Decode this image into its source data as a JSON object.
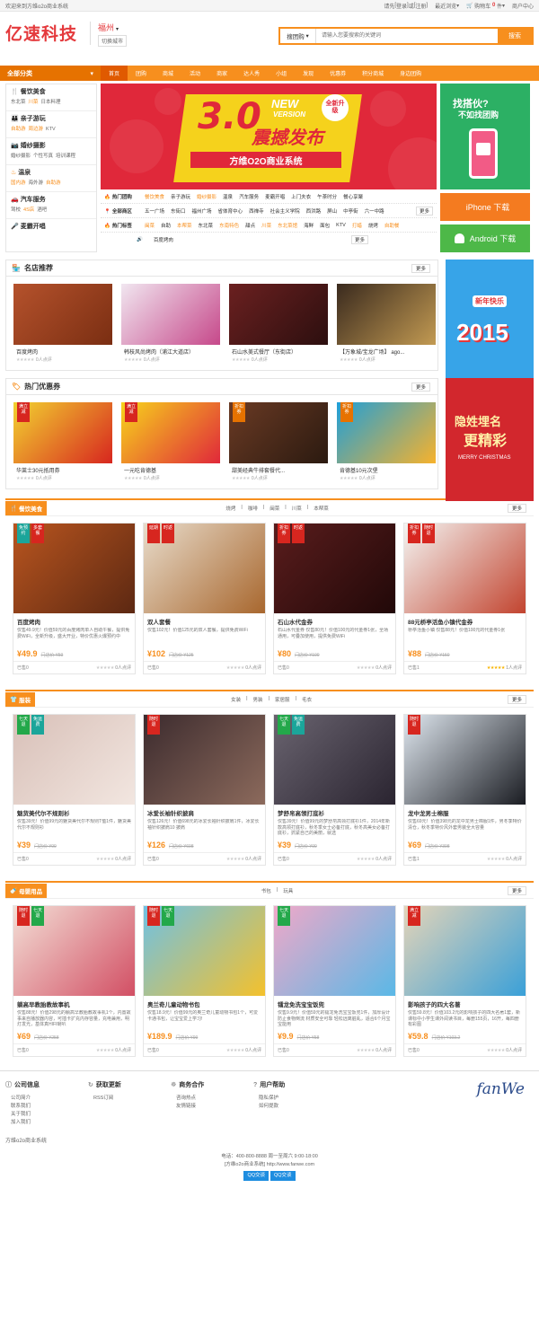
{
  "topbar": {
    "welcome": "欢迎来到方维o2o商业系统",
    "login_prompt": "请先",
    "login": "登录",
    "or": "或",
    "register": "注册",
    "recent": "最近浏览",
    "cart": "购物车",
    "cart_count": "0",
    "cart_unit": "件",
    "merchant": "商户中心"
  },
  "header": {
    "logo": "亿速科技",
    "city": "福州",
    "switch_city": "切换城市"
  },
  "search": {
    "category": "搜团购",
    "placeholder": "请输入您要搜索的关键词",
    "button": "搜索"
  },
  "nav": {
    "allcat": "全部分类",
    "items": [
      "首页",
      "团购",
      "商城",
      "活动",
      "商家",
      "达人秀",
      "小组",
      "发现",
      "优惠券",
      "积分商城",
      "身边团购"
    ]
  },
  "sidecat": [
    {
      "title": "餐饮美食",
      "subs": [
        "东北菜",
        "川菜",
        "日本料理"
      ],
      "hot": [
        1
      ]
    },
    {
      "title": "亲子游玩",
      "subs": [
        "自助游",
        "周边游",
        "KTV"
      ],
      "hot": [
        0,
        1
      ]
    },
    {
      "title": "婚纱摄影",
      "subs": [
        "婚纱摄影",
        "个性写真",
        "培训课程"
      ],
      "hot": []
    },
    {
      "title": "温泉",
      "subs": [
        "国内游",
        "海外游",
        "自助游"
      ],
      "hot": [
        0,
        2
      ]
    },
    {
      "title": "汽车服务",
      "subs": [
        "驾校",
        "4S店",
        "酒吧"
      ],
      "hot": [
        1
      ]
    },
    {
      "title": "麦霸开唱",
      "subs": [],
      "hot": []
    }
  ],
  "banner": {
    "big": "3.0",
    "new": "NEW",
    "version": "VERSION",
    "upgrade": "全新升级",
    "headline": "震撼发布",
    "sub": "方维O2O商业系统"
  },
  "tagrows": [
    {
      "label": "热门团购",
      "tags": [
        "餐饮美食",
        "亲子游玩",
        "婚纱摄影",
        "温泉",
        "汽车服务",
        "麦霸开唱",
        "上门夫衣",
        "午茶时分",
        "餐心享聚"
      ],
      "hot": [
        0,
        2
      ]
    },
    {
      "label": "全部商区",
      "tags": [
        "五一广场",
        "东街口",
        "福州广场",
        "省体育中心",
        "西禅寺",
        "社会主义学院",
        "西洪路",
        "屏山",
        "中亭街",
        "六一中路"
      ],
      "hot": [],
      "more": "更多"
    },
    {
      "label": "热门标签",
      "tags": [
        "闽菜",
        "自助",
        "本帮菜",
        "东北菜",
        "东南特色",
        "甜点",
        "川菜",
        "东北菜馆",
        "海鲜",
        "面包",
        "KTV",
        "打蜡",
        "烧烤",
        "自助餐"
      ],
      "hot": [
        0,
        2,
        4,
        6,
        7,
        11,
        13
      ]
    }
  ],
  "notice": {
    "text": "百度烤肉",
    "more": "更多"
  },
  "promo": {
    "line1": "找搭伙?",
    "line2": "不如找团购"
  },
  "downloads": [
    {
      "label": "iPhone 下载",
      "icon": "apple-icon",
      "color": "#f47b20"
    },
    {
      "label": "Android 下载",
      "icon": "android-icon",
      "color": "#f47b20"
    }
  ],
  "shops": {
    "title": "名店推荐",
    "more": "更多",
    "items": [
      {
        "name": "百度烤肉",
        "rate": "0人点评"
      },
      {
        "name": "韩枝风尚烤肉（浦江大道店）",
        "rate": "0人点评"
      },
      {
        "name": "石山水美式餐厅（东街店）",
        "rate": "0人点评"
      },
      {
        "name": "【万象城/宝龙广场】 ago...",
        "rate": "0人点评"
      }
    ]
  },
  "coupons": {
    "title": "热门优惠券",
    "more": "更多",
    "items": [
      {
        "name": "华莱士30元抵用券",
        "rate": "0人点评",
        "tag": "满立减"
      },
      {
        "name": "一元吃肯德基",
        "rate": "0人点评",
        "tag": "满立减"
      },
      {
        "name": "甜美经典牛排套餐代...",
        "rate": "0人点评",
        "tag": "折扣券"
      },
      {
        "name": "肯德基10元次堡",
        "rate": "0人点评",
        "tag": "折扣券"
      }
    ]
  },
  "poster1": {
    "line": "新年快乐",
    "year": "2015"
  },
  "poster2": {
    "line1": "隐姓埋名",
    "line2": "更精彩",
    "sub": "MERRY CHRISTMAS"
  },
  "food": {
    "title": "餐饮美食",
    "filters": [
      "烧烤",
      "咖啡",
      "闽菜",
      "川菜",
      "本帮菜"
    ],
    "more": "更多",
    "items": [
      {
        "title": "百度烤肉",
        "desc": "仅售49.9元！价值59元的百度烤肉单人自助午餐，提供免费WiFi，全新升级，盛大开业，特价优惠火爆预约中",
        "price": "¥49.9",
        "orig": "门店价 ¥59",
        "sold": "已售0",
        "rate": "0人点评",
        "tags": [
          "免预约",
          "多套餐"
        ],
        "stars": 0
      },
      {
        "title": "双人套餐",
        "desc": "仅售102元！价值125元的双人套餐，提供免费WiFi",
        "price": "¥102",
        "orig": "门店价 ¥125",
        "sold": "已售0",
        "rate": "0人点评",
        "tags": [
          "延期",
          "时返"
        ],
        "stars": 0
      },
      {
        "title": "石山水代金券",
        "desc": "石山水代金券 仅售80元！价值100元的代金券1张，全场通用，可叠加使用，提供免费WiFi",
        "price": "¥80",
        "orig": "门店价 ¥100",
        "sold": "已售0",
        "rate": "0人点评",
        "tags": [
          "折扣券",
          "时返"
        ],
        "stars": 0
      },
      {
        "title": "88元桥亭活鱼小镇代金券",
        "desc": "桥亭活鱼小镇 仅售88元！价值100元的代金券1张",
        "price": "¥88",
        "orig": "门店价 ¥150",
        "sold": "已售1",
        "rate": "1人点评",
        "tags": [
          "折扣券",
          "随时退"
        ],
        "stars": 5
      }
    ]
  },
  "cloth": {
    "title": "服装",
    "filters": [
      "女装",
      "男装",
      "家居服",
      "毛衣"
    ],
    "more": "更多",
    "items": [
      {
        "title": "魅货美代尔不规则衫",
        "desc": "仅售39元！价值99元的魅货美代尔不规则T恤1件，魅货美代尔不规则衫",
        "price": "¥39",
        "orig": "门店价 ¥99",
        "sold": "已售0",
        "rate": "0人点评",
        "tags": [
          "七天退",
          "免运费"
        ]
      },
      {
        "title": "冰爱长袖针织披肩",
        "desc": "仅售126元！价值698元的冰爱长袖针织披肩1件，冰爱长袖针织披肩10 披肩",
        "price": "¥126",
        "orig": "门店价 ¥698",
        "sold": "已售0",
        "rate": "0人点评",
        "tags": [
          "随时退"
        ]
      },
      {
        "title": "梦舒帛高领打底衫",
        "desc": "仅售39元！价值99元的梦舒帛高领打底衫1件，2014年新款高领打底衫，秋冬季女士必备打底，秋冬高美女必备打底衫，抓紧自己的美丽，就选",
        "price": "¥39",
        "orig": "门店价 ¥99",
        "sold": "已售0",
        "rate": "0人点评",
        "tags": [
          "七天退",
          "免运费"
        ]
      },
      {
        "title": "龙中龙男士棉服",
        "desc": "仅售69元！价值398元的龙中龙男士棉服1件，男冬季特价清仓，秋冬季特价风外套男装全大容量",
        "price": "¥69",
        "orig": "门店价 ¥398",
        "sold": "已售1",
        "rate": "0人点评",
        "tags": [
          "随时退"
        ]
      }
    ]
  },
  "baby": {
    "title": "母婴用品",
    "filters": [
      "书包",
      "玩具"
    ],
    "more": "更多",
    "items": [
      {
        "title": "躺高早教胎教故事机",
        "desc": "仅售88元！价值298元的躺高早教胎教故事机1个，内置故事来自播放器内容，可插卡扩充内存容量，充电兼用，明灯发光，基体真HIFI喇叭",
        "price": "¥69",
        "orig": "门店价 ¥258",
        "sold": "已售0",
        "rate": "0人点评",
        "tags": [
          "随时退",
          "七天退"
        ]
      },
      {
        "title": "奥兰奇儿童动物书包",
        "desc": "仅售18.9元！价值99元的奥兰奇儿童动物书包1个，可爱卡通书包，让宝宝爱上学习!",
        "price": "¥189.9",
        "orig": "门店价 ¥99",
        "sold": "已售0",
        "rate": "0人点评",
        "tags": [
          "随时退",
          "七天退"
        ]
      },
      {
        "title": "镭龙免洗宝宝饭兜",
        "desc": "仅售9.9元！价值59元的镭龙免洗宝宝饭兜1件，加厚设计 防止食物倒流 材质安全可靠 轻松远离脏乱，适合6个月宝宝能用",
        "price": "¥9.9",
        "orig": "门店价 ¥58",
        "sold": "已售0",
        "rate": "0人点评",
        "tags": [
          "七天退"
        ]
      },
      {
        "title": "影响孩子的四大名著",
        "desc": "仅售59.8元！价值103.2元的影响孩子的四大名著1套，新课标中小学生课外阅读书目，每册155页，16开，每四册有彩图",
        "price": "¥59.8",
        "orig": "门店价 ¥103.2",
        "sold": "已售0",
        "rate": "0人点评",
        "tags": [
          "满立减"
        ]
      }
    ]
  },
  "footer": {
    "cols": [
      {
        "title": "公司信息",
        "icon": "info-icon",
        "items": [
          "公司简介",
          "联系我们",
          "关于我们",
          "加入我们"
        ]
      },
      {
        "title": "获取更新",
        "icon": "rss-icon",
        "items": [
          "RSS订阅"
        ]
      },
      {
        "title": "商务合作",
        "icon": "handshake-icon",
        "items": [
          "咨询热点",
          "友情链接"
        ]
      },
      {
        "title": "用户帮助",
        "icon": "help-icon",
        "items": [
          "隐私保护",
          "如何提款"
        ]
      }
    ],
    "logo": "fanWe",
    "copyright": "方维o2o商业系统",
    "phone": "电话：400-800-8888 周一至周六 9:00-18:00",
    "site": "[方维o2o商业系统] http://www.fanwe.com",
    "qq1": "QQ交谈",
    "qq2": "QQ交谈"
  },
  "colors": {
    "accent": "#f78f1e",
    "brand": "#e4393c"
  }
}
